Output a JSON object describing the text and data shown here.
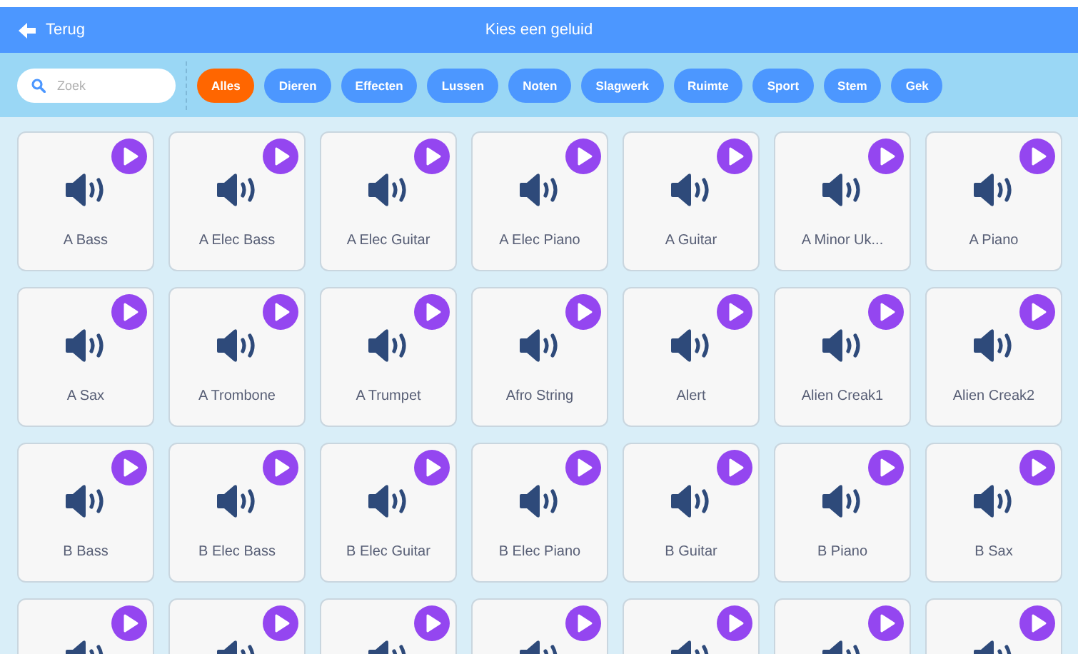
{
  "header": {
    "back_label": "Terug",
    "title": "Kies een geluid"
  },
  "search": {
    "placeholder": "Zoek"
  },
  "filters": [
    {
      "label": "Alles",
      "selected": true
    },
    {
      "label": "Dieren",
      "selected": false
    },
    {
      "label": "Effecten",
      "selected": false
    },
    {
      "label": "Lussen",
      "selected": false
    },
    {
      "label": "Noten",
      "selected": false
    },
    {
      "label": "Slagwerk",
      "selected": false
    },
    {
      "label": "Ruimte",
      "selected": false
    },
    {
      "label": "Sport",
      "selected": false
    },
    {
      "label": "Stem",
      "selected": false
    },
    {
      "label": "Gek",
      "selected": false
    }
  ],
  "sounds": [
    {
      "kind": "full",
      "name": "A Bass"
    },
    {
      "kind": "full",
      "name": "A Elec Bass"
    },
    {
      "kind": "full",
      "name": "A Elec Guitar"
    },
    {
      "kind": "full",
      "name": "A Elec Piano"
    },
    {
      "kind": "full",
      "name": "A Guitar"
    },
    {
      "kind": "full",
      "name": "A Minor Uk..."
    },
    {
      "kind": "full",
      "name": "A Piano"
    },
    {
      "kind": "full",
      "name": "A Sax"
    },
    {
      "kind": "full",
      "name": "A Trombone"
    },
    {
      "kind": "full",
      "name": "A Trumpet"
    },
    {
      "kind": "full",
      "name": "Afro String"
    },
    {
      "kind": "full",
      "name": "Alert"
    },
    {
      "kind": "full",
      "name": "Alien Creak1"
    },
    {
      "kind": "full",
      "name": "Alien Creak2"
    },
    {
      "kind": "full",
      "name": "B Bass"
    },
    {
      "kind": "full",
      "name": "B Elec Bass"
    },
    {
      "kind": "full",
      "name": "B Elec Guitar"
    },
    {
      "kind": "full",
      "name": "B Elec Piano"
    },
    {
      "kind": "full",
      "name": "B Guitar"
    },
    {
      "kind": "full",
      "name": "B Piano"
    },
    {
      "kind": "full",
      "name": "B Sax"
    },
    {
      "kind": "cut_off"
    },
    {
      "kind": "cut_off"
    },
    {
      "kind": "cut_off"
    },
    {
      "kind": "cut_off"
    },
    {
      "kind": "cut_off"
    },
    {
      "kind": "cut_off"
    },
    {
      "kind": "cut_off"
    }
  ]
}
